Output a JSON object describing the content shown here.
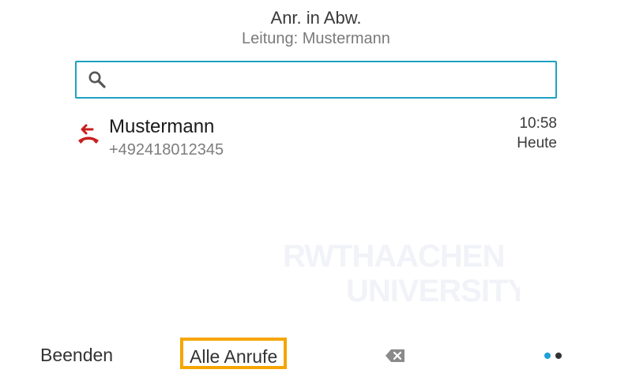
{
  "header": {
    "title": "Anr. in Abw.",
    "subtitle": "Leitung: Mustermann"
  },
  "search": {
    "value": "",
    "placeholder": "",
    "icon": "search-icon"
  },
  "calls": [
    {
      "name": "Mustermann",
      "number": "+492418012345",
      "time": "10:58",
      "day": "Heute",
      "icon": "missed-call-icon",
      "icon_color": "#c81e1e"
    }
  ],
  "watermark": {
    "line1": "RWTHAACHEN",
    "line2": "UNIVERSITY"
  },
  "softkeys": {
    "end_label": "Beenden",
    "all_calls_label": "Alle Anrufe",
    "backspace_icon": "backspace-icon",
    "selected_color": "#f5a500"
  },
  "pager": {
    "active_color": "#1ea0d8",
    "inactive_color": "#333333"
  },
  "colors": {
    "accent": "#1ea0c3"
  }
}
